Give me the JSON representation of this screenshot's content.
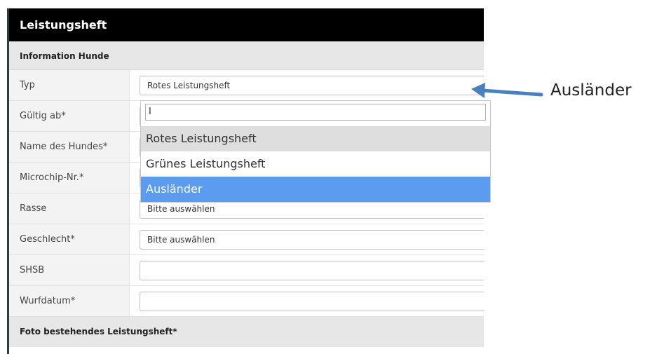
{
  "panel": {
    "title": "Leistungsheft",
    "section": "Information Hunde",
    "footer_section": "Foto bestehendes Leistungsheft*"
  },
  "rows": [
    {
      "label": "Typ",
      "value": "Rotes Leistungsheft"
    },
    {
      "label": "Gültig ab*",
      "value": ""
    },
    {
      "label": "Name des Hundes*",
      "value": ""
    },
    {
      "label": "Microchip-Nr.*",
      "value": ""
    },
    {
      "label": "Rasse",
      "value": "Bitte auswählen"
    },
    {
      "label": "Geschlecht*",
      "value": "Bitte auswählen"
    },
    {
      "label": "SHSB",
      "value": ""
    },
    {
      "label": "Wurfdatum*",
      "value": ""
    }
  ],
  "dropdown": {
    "search_value": "I",
    "options": [
      "Rotes Leistungsheft",
      "Grünes Leistungsheft",
      "Ausländer"
    ]
  },
  "annotation": {
    "text": "Ausländer",
    "arrow_color": "#4a7fc0"
  }
}
